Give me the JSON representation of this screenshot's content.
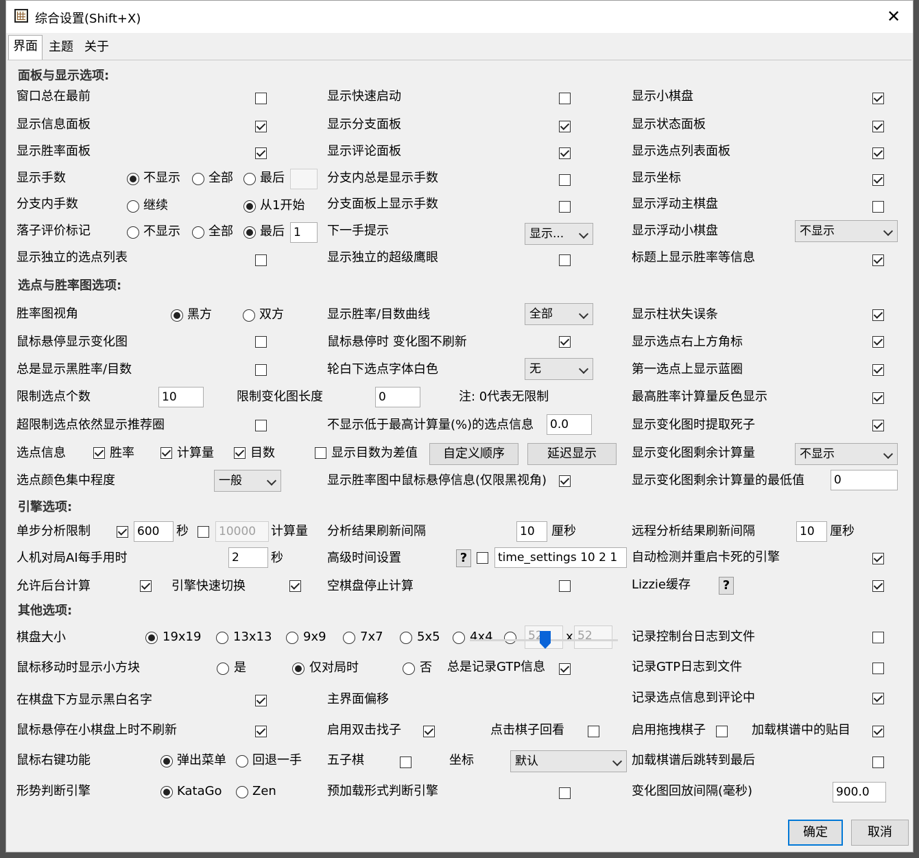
{
  "window": {
    "title": "综合设置(Shift+X)",
    "close_glyph": "✕"
  },
  "tabs": [
    "界面",
    "主题",
    "关于"
  ],
  "sections": {
    "panel": "面板与显示选项:",
    "winrate": "选点与胜率图选项:",
    "engine": "引擎选项:",
    "other": "其他选项:"
  },
  "labels": {
    "always_on_top": "窗口总在最前",
    "show_info_panel": "显示信息面板",
    "show_winrate_panel": "显示胜率面板",
    "show_move_number": "显示手数",
    "branch_move_number": "分支内手数",
    "eval_marker": "落子评价标记",
    "independent_list": "显示独立的选点列表",
    "quick_start": "显示快速启动",
    "branch_panel": "显示分支面板",
    "comment_panel": "显示评论面板",
    "branch_always_number": "分支内总是显示手数",
    "branch_panel_number": "分支面板上显示手数",
    "next_hint": "下一手提示",
    "independent_eagle": "显示独立的超级鹰眼",
    "small_board": "显示小棋盘",
    "status_panel": "显示状态面板",
    "candidate_list_panel": "显示选点列表面板",
    "coords": "显示坐标",
    "floating_main": "显示浮动主棋盘",
    "floating_small": "显示浮动小棋盘",
    "title_winrate": "标题上显示胜率等信息",
    "winrate_view": "胜率图视角",
    "hover_change_graph": "鼠标悬停显示变化图",
    "always_black_winrate": "总是显示黑胜率/目数",
    "limit_candidates": "限制选点个数",
    "beyond_limit_ring": "超限制选点依然显示推荐圈",
    "candidate_info": "选点信息",
    "color_concentration": "选点颜色集中程度",
    "winrate_curve": "显示胜率/目数曲线",
    "hover_no_refresh": "鼠标悬停时 变化图不刷新",
    "white_font_turn": "轮白下选点字体白色",
    "limit_graph_len": "限制变化图长度",
    "zero_note": "注: 0代表无限制",
    "hide_low_playouts": "不显示低于最高计算量(%)的选点信息",
    "diff_display": "显示目数为差值",
    "hover_info_black": "显示胜率图中鼠标悬停信息(仅限黑视角)",
    "bar_loss": "显示柱状失误条",
    "corner_marker": "显示选点右上方角标",
    "first_blue_circle": "第一选点上显示蓝圈",
    "invert_max_playouts": "最高胜率计算量反色显示",
    "extract_dead": "显示变化图时提取死子",
    "remaining_playouts": "显示变化图剩余计算量",
    "remaining_min": "显示变化图剩余计算量的最低值",
    "step_limit": "单步分析限制",
    "ai_time": "人机对局AI每手用时",
    "allow_bg": "允许后台计算",
    "fast_switch": "引擎快速切换",
    "refresh_interval": "分析结果刷新间隔",
    "advanced_time": "高级时间设置",
    "empty_stop": "空棋盘停止计算",
    "remote_refresh": "远程分析结果刷新间隔",
    "auto_restart": "自动检测并重启卡死的引擎",
    "lizzie_cache": "Lizzie缓存",
    "board_size": "棋盘大小",
    "mouse_square": "鼠标移动时显示小方块",
    "names_below": "在棋盘下方显示黑白名字",
    "hover_small_norefresh": "鼠标悬停在小棋盘上时不刷新",
    "right_click": "鼠标右键功能",
    "judge_engine": "形势判断引擎",
    "always_gtp": "总是记录GTP信息",
    "main_offset": "主界面偏移",
    "double_click_find": "启用双击找子",
    "click_review": "点击棋子回看",
    "gomoku": "五子棋",
    "coordinate": "坐标",
    "preload_judge": "预加载形式判断引擎",
    "console_log": "记录控制台日志到文件",
    "gtp_log": "记录GTP日志到文件",
    "candidate_to_comment": "记录选点信息到评论中",
    "enable_drag": "启用拖拽棋子",
    "load_komi": "加载棋谱中的贴目",
    "jump_to_last": "加载棋谱后跳转到最后",
    "replay_interval": "变化图回放间隔(毫秒)"
  },
  "radios": {
    "not_show": "不显示",
    "all": "全部",
    "last": "最后",
    "continue": "继续",
    "from_1": "从1开始",
    "black": "黑方",
    "both": "双方",
    "yes": "是",
    "only_in_game": "仅对局时",
    "no": "否",
    "popup_menu": "弹出菜单",
    "undo_one": "回退一手",
    "katago": "KataGo",
    "zen": "Zen",
    "s19": "19x19",
    "s13": "13x13",
    "s9": "9x9",
    "s7": "7x7",
    "s5": "5x5",
    "s4": "4x4"
  },
  "checkbox_labels": {
    "winrate": "胜率",
    "playouts": "计算量",
    "score": "目数",
    "diff": "显示目数为差值",
    "playouts_unit": "计算量"
  },
  "units": {
    "sec": "秒",
    "centisec": "厘秒",
    "x": "x"
  },
  "inputs": {
    "last_n_move": "",
    "eval_last_n": "1",
    "limit_candidates": "10",
    "limit_graph": "0",
    "min_playouts_pct": "0.0",
    "remaining_min": "0",
    "step_seconds": "600",
    "step_playouts": "10000",
    "ai_time": "2",
    "refresh": "10",
    "time_settings": "time_settings 10 2 1",
    "remote_refresh": "10",
    "custom_w": "52",
    "custom_h": "52",
    "replay_interval": "900.0"
  },
  "selects": {
    "next_hint": "显示...",
    "floating_small": "不显示",
    "winrate_curve": "全部",
    "white_font": "无",
    "color_conc": "一般",
    "remaining_playouts": "不显示",
    "coordinate": "默认"
  },
  "buttons": {
    "custom_order": "自定义顺序",
    "delay_show": "延迟显示",
    "ok": "确定",
    "cancel": "取消",
    "help": "?"
  }
}
